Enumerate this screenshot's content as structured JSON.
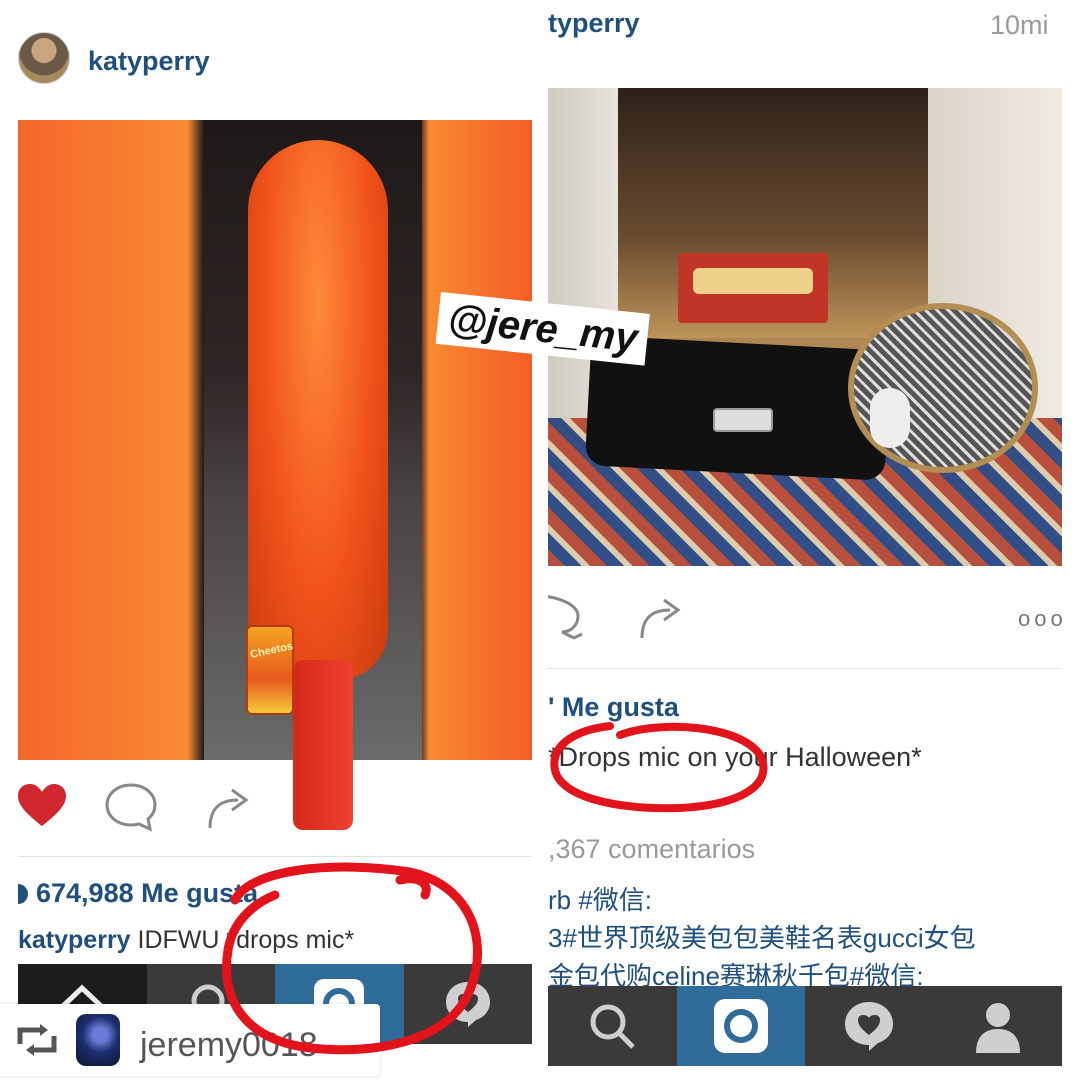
{
  "left_post": {
    "username": "katyperry",
    "likes_text": "674,988 Me gusta",
    "caption_user": "katyperry",
    "caption_text": " IDFWU *drops mic*",
    "bag_label": "Cheetos"
  },
  "watermark": "@jere_my",
  "right_post": {
    "username": "typerry",
    "time": "10mi",
    "likes_text": "' Me gusta",
    "caption_text": "*Drops mic on your Halloween*",
    "comments_count": ",367 comentarios",
    "comment_line_1": "rb #微信:",
    "comment_line_2": "3#世界顶级美包包美鞋名表gucci女包",
    "comment_line_3": "金包代购celine赛琳秋千包#微信:",
    "more_label": "ooo"
  },
  "repost": {
    "username": "jeremy0018"
  },
  "colors": {
    "link_blue": "#1f4f7c",
    "heart_red": "#d0262d",
    "marker_red": "#e3131b",
    "tab_active": "#2f6c99"
  },
  "icons": [
    "heart-icon",
    "comment-icon",
    "share-icon",
    "home-icon",
    "search-icon",
    "camera-icon",
    "activity-icon",
    "profile-icon",
    "repost-icon",
    "more-icon"
  ]
}
